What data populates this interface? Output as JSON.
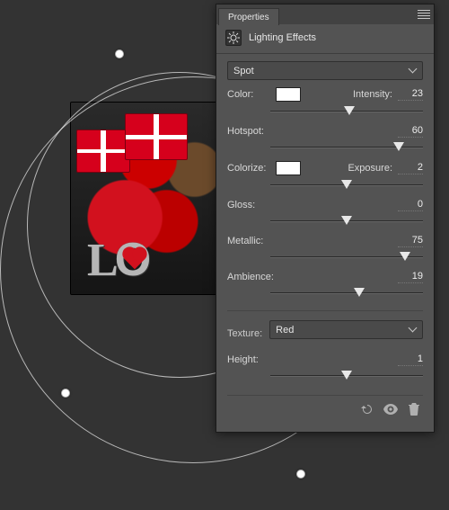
{
  "panel": {
    "tab": "Properties",
    "title": "Lighting Effects",
    "light_type": "Spot",
    "color": {
      "label": "Color:",
      "swatch": "#ffffff"
    },
    "intensity": {
      "label": "Intensity:",
      "value": "23",
      "pct": 52
    },
    "hotspot": {
      "label": "Hotspot:",
      "value": "60",
      "pct": 84
    },
    "colorize": {
      "label": "Colorize:",
      "swatch": "#ffffff"
    },
    "exposure": {
      "label": "Exposure:",
      "value": "2",
      "pct": 50
    },
    "gloss": {
      "label": "Gloss:",
      "value": "0",
      "pct": 50
    },
    "metallic": {
      "label": "Metallic:",
      "value": "75",
      "pct": 88
    },
    "ambience": {
      "label": "Ambience:",
      "value": "19",
      "pct": 58
    },
    "texture": {
      "label": "Texture:",
      "value": "Red"
    },
    "height": {
      "label": "Height:",
      "value": "1",
      "pct": 50
    }
  }
}
